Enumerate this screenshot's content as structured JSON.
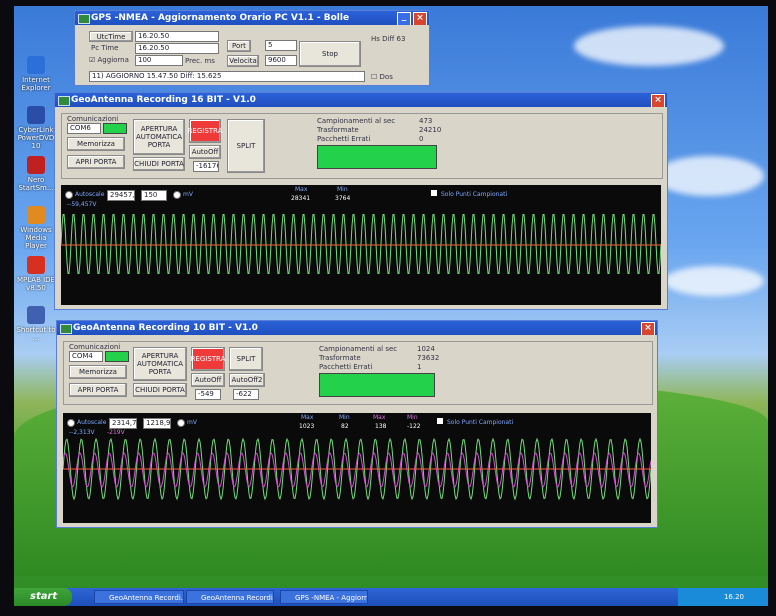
{
  "desktop": {
    "icons": [
      {
        "label": "Internet Explorer",
        "color": "#2a70d8"
      },
      {
        "label": "CyberLink PowerDVD 10",
        "color": "#2a4ea8"
      },
      {
        "label": "Nero StartSm...",
        "color": "#c02020"
      },
      {
        "label": "Windows Media Player",
        "color": "#e08a20"
      },
      {
        "label": "MPLAB IDE v8.50",
        "color": "#d83020"
      },
      {
        "label": "Shortcut to ...",
        "color": "#4060b0"
      }
    ]
  },
  "gps_window": {
    "title": "GPS -NMEA - Aggiornamento Orario PC V1.1 - Bolle",
    "utc_label": "UtcTime",
    "utc_value": "16.20.50",
    "pc_label": "Pc Time",
    "pc_value": "16.20.50",
    "aggiorna_label": "Aggiorna",
    "aggiorna_value": "100",
    "prec_label": "Prec. ms",
    "porta_label": "Port",
    "porta_value": "5",
    "velocita_label": "Velocita",
    "velocita_value": "9600",
    "stop_label": "Stop",
    "hs_label": "Hs Diff",
    "hs_value": "63",
    "status": "11) AGGIORNO 15.47.50 Diff: 15.625",
    "dos_label": "Dos"
  },
  "rec16": {
    "title": "GeoAntenna Recording 16 BIT - V1.0",
    "group_label": "Comunicazioni",
    "com_value": "COM6",
    "memorizza": "Memorizza",
    "apri_porta": "APRI PORTA",
    "apertura": "APERTURA AUTOMATICA PORTA",
    "chiudi_porta": "CHIUDI PORTA",
    "registra": "REGISTRA",
    "auto_off": "AutoOff",
    "auto_val": "-16176",
    "split": "SPLIT",
    "camp_label": "Campionamenti al sec",
    "camp_value": "473",
    "traf_label": "Trasformate",
    "traf_value": "24210",
    "pac_label": "Pacchetti Errati",
    "pac_value": "0",
    "autoscale": "Autoscale",
    "scale1": "29457,",
    "scale2": "150",
    "mv": "mV",
    "max_label": "Max",
    "max_value": "28341",
    "min_label": "Min",
    "min_value": "3764",
    "solo": "Solo Punti Campionati",
    "readout": "--59,457V"
  },
  "rec10": {
    "title": "GeoAntenna Recording 10 BIT - V1.0",
    "group_label": "Comunicazioni",
    "com_value": "COM4",
    "memorizza": "Memorizza",
    "apri_porta": "APRI PORTA",
    "apertura": "APERTURA AUTOMATICA PORTA",
    "chiudi_porta": "CHIUDI PORTA",
    "registra": "REGISTRA",
    "split": "SPLIT",
    "auto_off1": "AutoOff",
    "auto_off2": "AutoOff2",
    "auto_val1": "-549",
    "auto_val2": "-622",
    "camp_label": "Campionamenti al sec",
    "camp_value": "1024",
    "traf_label": "Trasformate",
    "traf_value": "73632",
    "pac_label": "Pacchetti Errati",
    "pac_value": "1",
    "autoscale": "Autoscale",
    "scale1": "2314,7",
    "scale2": "1218,9",
    "mv": "mV",
    "max_label": "Max",
    "max_value": "1023",
    "min_label": "Min",
    "min_value": "82",
    "max2_label": "Max",
    "max2_value": "138",
    "min2_label": "Min",
    "min2_value": "-122",
    "solo": "Solo Punti Campionati",
    "readout1": "--2,313V",
    "readout2": "-219V"
  },
  "taskbar": {
    "start": "start",
    "items": [
      "GeoAntenna Recordi...",
      "GeoAntenna Recordi...",
      "GPS -NMEA - Aggiorn..."
    ],
    "clock": "16.20"
  },
  "colors": {
    "trace_green": "#6fe07a",
    "trace_magenta": "#d050d0",
    "trace_red": "#ff5a3a"
  }
}
